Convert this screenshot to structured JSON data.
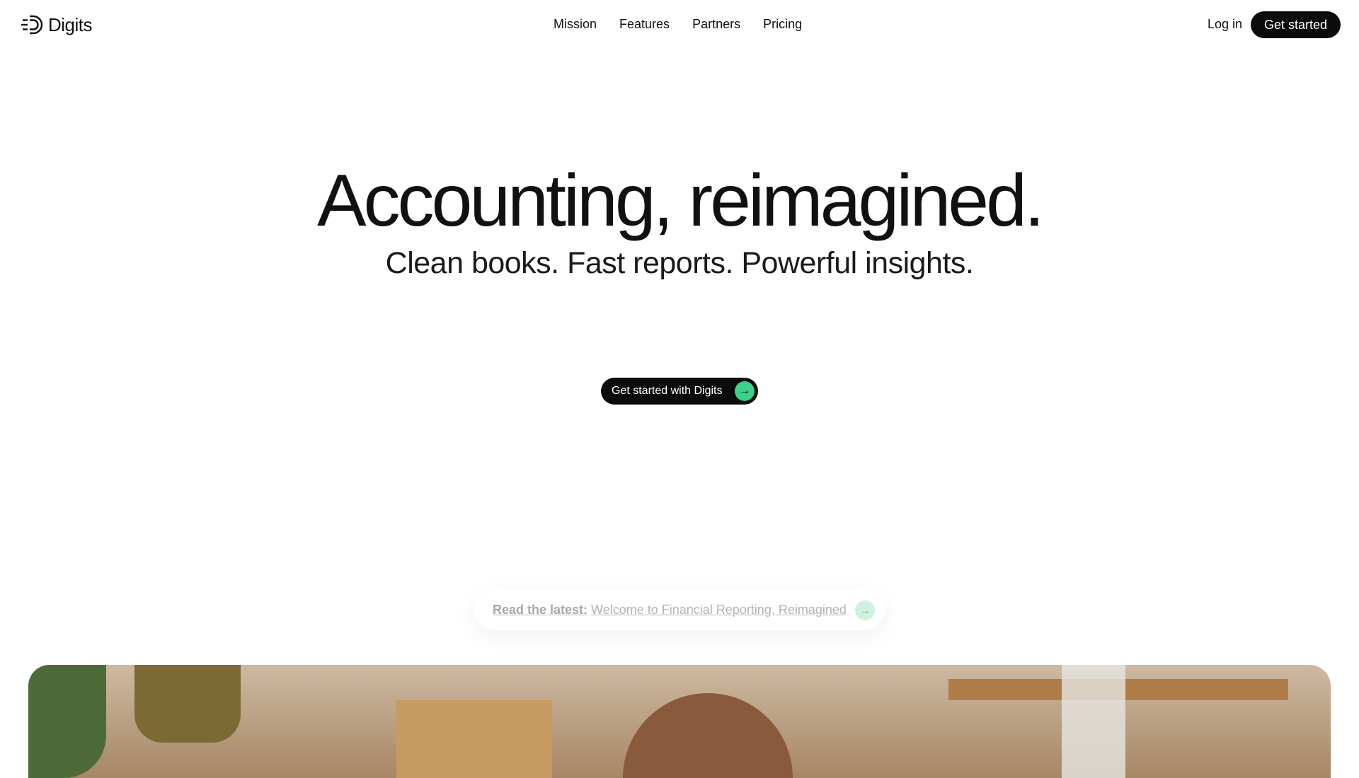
{
  "header": {
    "logo_text": "Digits",
    "nav": [
      "Mission",
      "Features",
      "Partners",
      "Pricing"
    ],
    "login_label": "Log in",
    "cta_label": "Get started"
  },
  "hero": {
    "title": "Accounting, reimagined.",
    "subtitle": "Clean books. Fast reports. Powerful insights.",
    "cta_label": "Get started with Digits"
  },
  "latest": {
    "label": "Read the latest:",
    "text": "Welcome to Financial Reporting, Reimagined"
  },
  "colors": {
    "brand_dark": "#0b0b0b",
    "accent_green": "#3ad18a"
  }
}
